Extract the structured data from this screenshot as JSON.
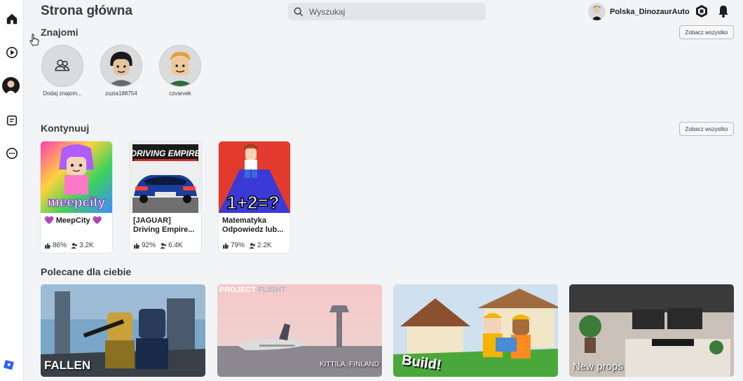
{
  "header": {
    "title": "Strona główna"
  },
  "search": {
    "placeholder": "Wyszukaj"
  },
  "user": {
    "name": "Polska_DinozaurAuto"
  },
  "friends": {
    "title": "Znajomi",
    "see_all": "Zobacz wszystko",
    "items": [
      {
        "name": "Dodaj znajom..."
      },
      {
        "name": "zuzia188754"
      },
      {
        "name": "czvarvek"
      }
    ]
  },
  "continue": {
    "title": "Kontynuuj",
    "see_all": "Zobacz wszystko",
    "games": [
      {
        "title": "💜 MeepCity 💜",
        "thumb_text": "meepcity",
        "rating": "86%",
        "players": "3.2K"
      },
      {
        "title": "[JAGUAR] Driving Empire...",
        "thumb_text": "DRIVING EMPIRE",
        "rating": "92%",
        "players": "6.4K"
      },
      {
        "title": "Matematyka Odpowiedz lub...",
        "thumb_text": "1+2=?",
        "rating": "79%",
        "players": "2.2K"
      }
    ]
  },
  "recommended": {
    "title": "Polecane dla ciebie",
    "items": [
      {
        "caption": "FALLEN"
      },
      {
        "caption": "KITTILA, FINLAND",
        "overlay_part1": "PROJECT",
        "overlay_part2": "FLIGHT"
      },
      {
        "caption": "Build!"
      },
      {
        "caption": "New props"
      }
    ]
  },
  "colors": {
    "accent": "#335fff",
    "background": "#f2f4f5",
    "button_border": "#b8babc"
  }
}
